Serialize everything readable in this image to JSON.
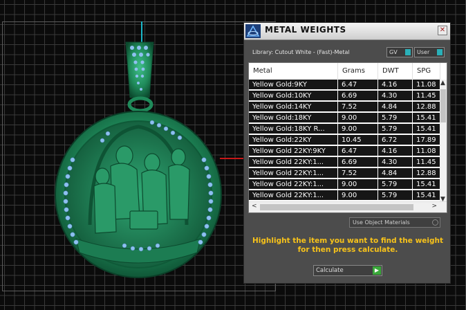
{
  "dialog": {
    "title": "METAL WEIGHTS",
    "close_glyph": "✕",
    "library_label": "Library: Cutout White - (Fast)-Metal",
    "toggles": {
      "gv": "GV",
      "user": "User"
    },
    "columns": [
      "Metal",
      "Grams",
      "DWT",
      "SPG"
    ],
    "rows": [
      [
        "Yellow Gold:9KY",
        "6.47",
        "4.16",
        "11.08"
      ],
      [
        "Yellow Gold:10KY",
        "6.69",
        "4.30",
        "11.45"
      ],
      [
        "Yellow Gold:14KY",
        "7.52",
        "4.84",
        "12.88"
      ],
      [
        "Yellow Gold:18KY",
        "9.00",
        "5.79",
        "15.41"
      ],
      [
        "Yellow Gold:18KY R...",
        "9.00",
        "5.79",
        "15.41"
      ],
      [
        "Yellow Gold:22KY",
        "10.45",
        "6.72",
        "17.89"
      ],
      [
        "Yellow Gold 22KY:9KY",
        "6.47",
        "4.16",
        "11.08"
      ],
      [
        "Yellow Gold 22KY:1...",
        "6.69",
        "4.30",
        "11.45"
      ],
      [
        "Yellow Gold 22KY:1...",
        "7.52",
        "4.84",
        "12.88"
      ],
      [
        "Yellow Gold 22KY:1...",
        "9.00",
        "5.79",
        "15.41"
      ],
      [
        "Yellow Gold 22KY:1...",
        "9.00",
        "5.79",
        "15.41"
      ]
    ],
    "use_object_materials": "Use Object Materials",
    "hint": "Highlight the item you want to find the weight for then press calculate.",
    "calculate_label": "Calculate"
  },
  "icons": {
    "title": "gemvision-logo-icon",
    "close": "close-icon",
    "scroll_up": "▲",
    "scroll_down": "▼",
    "scroll_left": "<",
    "scroll_right": ">",
    "go": "▶"
  },
  "colors": {
    "pendant": "#1f8a5a",
    "gems": "#7aaee8",
    "hint_text": "#f7c21a",
    "axis_y": "#19b7c9",
    "axis_x": "#c81818"
  }
}
